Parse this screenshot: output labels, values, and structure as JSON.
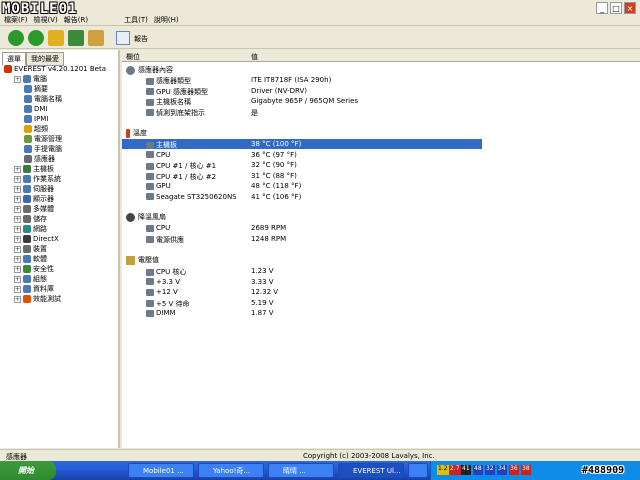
{
  "logo": "MOBILE01",
  "window_controls": [
    "_",
    "□",
    "×"
  ],
  "menu": [
    "檔案(F)",
    "檢視(V)",
    "報告(R)",
    "工具(T)",
    "說明(H)"
  ],
  "toolbar": {
    "report_label": "報告"
  },
  "tabs": [
    "選單",
    "我的最愛"
  ],
  "tree": [
    {
      "label": "EVEREST v4.20.1201 Beta",
      "color": "#cc3300"
    },
    {
      "label": "電腦",
      "color": "#4a7ab5"
    },
    {
      "label": "摘要",
      "color": "#4a7ab5"
    },
    {
      "label": "電腦名稱",
      "color": "#4a7ab5"
    },
    {
      "label": "DMI",
      "color": "#4a7ab5"
    },
    {
      "label": "IPMI",
      "color": "#4a7ab5"
    },
    {
      "label": "超頻",
      "color": "#e0a000"
    },
    {
      "label": "電源管理",
      "color": "#6a9a3a"
    },
    {
      "label": "手提電腦",
      "color": "#4a7ab5"
    },
    {
      "label": "感應器",
      "color": "#6a6a6a"
    },
    {
      "label": "主機板",
      "color": "#3a7a3a"
    },
    {
      "label": "作業系統",
      "color": "#4a7ab5"
    },
    {
      "label": "伺服器",
      "color": "#4a7ab5"
    },
    {
      "label": "顯示器",
      "color": "#3a6ab5"
    },
    {
      "label": "多媒體",
      "color": "#6a6a6a"
    },
    {
      "label": "儲存",
      "color": "#6a6a6a"
    },
    {
      "label": "網路",
      "color": "#2a8a8a"
    },
    {
      "label": "DirectX",
      "color": "#3a3a3a"
    },
    {
      "label": "裝置",
      "color": "#6a6a6a"
    },
    {
      "label": "軟體",
      "color": "#4a7ab5"
    },
    {
      "label": "安全性",
      "color": "#3a8a3a"
    },
    {
      "label": "組態",
      "color": "#4a7ab5"
    },
    {
      "label": "資料庫",
      "color": "#4a7ab5"
    },
    {
      "label": "效能測試",
      "color": "#e05000"
    }
  ],
  "columns": {
    "field": "欄位",
    "value": "值"
  },
  "sections": {
    "sensor": "感應器內容",
    "temperature": "溫度",
    "fan": "降溫風扇",
    "voltage": "電壓值"
  },
  "sensor_rows": [
    {
      "field": "感應器類型",
      "value": "ITE IT8718F (ISA 290h)"
    },
    {
      "field": "GPU 感應器類型",
      "value": "Driver (NV-DRV)"
    },
    {
      "field": "主機板名稱",
      "value": "Gigabyte 965P / 965QM Series"
    },
    {
      "field": "偵測到底架指示",
      "value": "是"
    }
  ],
  "temp_rows": [
    {
      "field": "主機板",
      "value": "38 °C (100 °F)"
    },
    {
      "field": "CPU",
      "value": "36 °C (97 °F)"
    },
    {
      "field": "CPU #1 / 核心 #1",
      "value": "32 °C (90 °F)"
    },
    {
      "field": "CPU #1 / 核心 #2",
      "value": "31 °C (88 °F)"
    },
    {
      "field": "GPU",
      "value": "48 °C (118 °F)"
    },
    {
      "field": "Seagate ST3250620NS",
      "value": "41 °C (106 °F)"
    }
  ],
  "fan_rows": [
    {
      "field": "CPU",
      "value": "2689 RPM"
    },
    {
      "field": "電源供應",
      "value": "1248 RPM"
    }
  ],
  "volt_rows": [
    {
      "field": "CPU 核心",
      "value": "1.23 V"
    },
    {
      "field": "+3.3 V",
      "value": "3.33 V"
    },
    {
      "field": "+12 V",
      "value": "12.32 V"
    },
    {
      "field": "+5 V 待命",
      "value": "5.19 V"
    },
    {
      "field": "DIMM",
      "value": "1.87 V"
    }
  ],
  "status": {
    "left": "感應器",
    "center": "Copyright (c) 2003-2008 Lavalys, Inc."
  },
  "taskbar": {
    "start": "開始",
    "tasks": [
      "Mobile01 ...",
      "Yahoo!奇...",
      "睛晴 ...",
      "EVEREST Ul...",
      ""
    ]
  },
  "tray": [
    "1.2",
    "2.7",
    "41",
    "48",
    "32",
    "34",
    "36",
    "38"
  ],
  "watermark": "#488909"
}
